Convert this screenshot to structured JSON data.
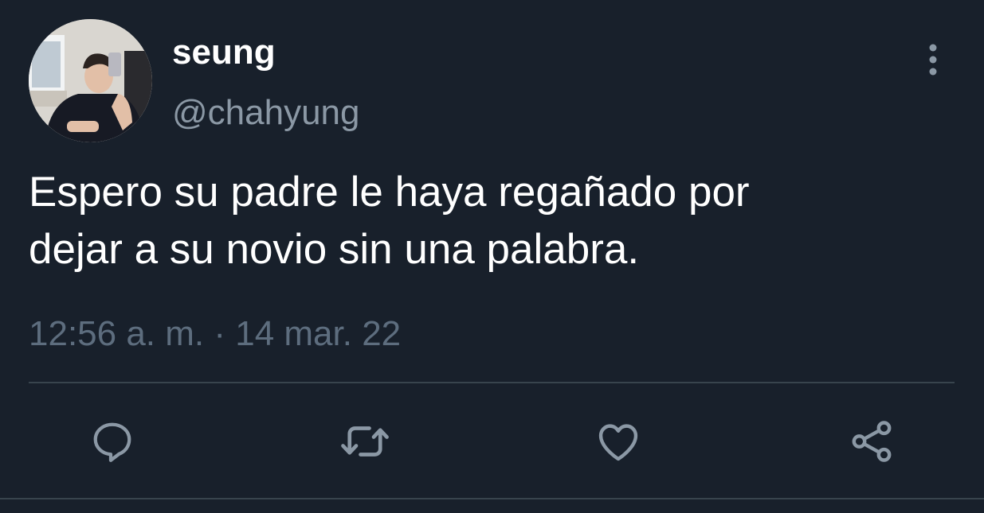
{
  "tweet": {
    "author": {
      "display_name": "seung",
      "handle": "@chahyung"
    },
    "text_lines": [
      "Espero su padre le haya regañado por",
      "dejar a su novio sin una palabra."
    ],
    "timestamp": "12:56 a. m. · 14 mar. 22"
  },
  "actions": [
    {
      "name": "reply",
      "icon": "reply-icon"
    },
    {
      "name": "retweet",
      "icon": "retweet-icon"
    },
    {
      "name": "like",
      "icon": "heart-icon"
    },
    {
      "name": "share",
      "icon": "share-icon"
    }
  ],
  "colors": {
    "background": "#18202b",
    "text_primary": "#ffffff",
    "text_secondary": "#8b98a5",
    "timestamp": "#5d6d7e",
    "icon": "#8b98a5",
    "divider": "#38444d"
  }
}
